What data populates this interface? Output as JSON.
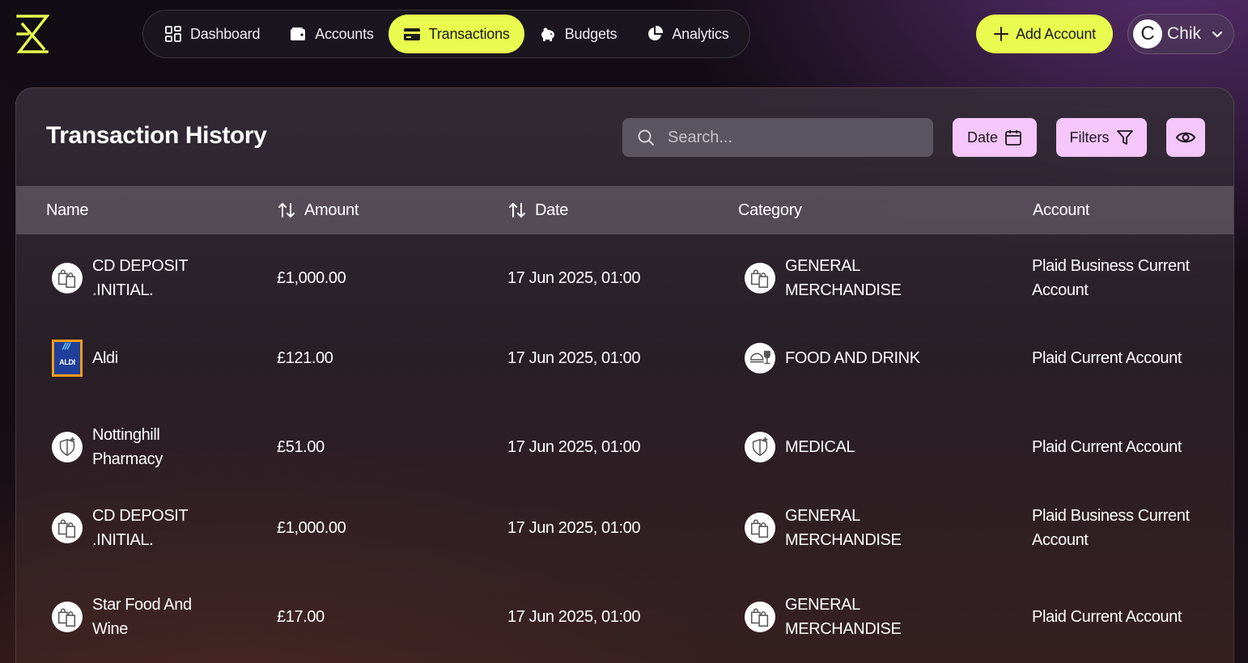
{
  "nav": {
    "items": [
      {
        "label": "Dashboard",
        "icon": "dashboard-icon"
      },
      {
        "label": "Accounts",
        "icon": "wallet-icon"
      },
      {
        "label": "Transactions",
        "icon": "credit-card-icon",
        "active": true
      },
      {
        "label": "Budgets",
        "icon": "piggy-bank-icon"
      },
      {
        "label": "Analytics",
        "icon": "pie-chart-icon"
      }
    ]
  },
  "header": {
    "add_account_label": "Add Account",
    "user_initial": "C",
    "user_name": "Chik"
  },
  "card": {
    "title": "Transaction History",
    "search_placeholder": "Search...",
    "date_button": "Date",
    "filters_button": "Filters"
  },
  "table": {
    "headers": {
      "name": "Name",
      "amount": "Amount",
      "date": "Date",
      "category": "Category",
      "account": "Account"
    },
    "rows": [
      {
        "name_l1": "CD DEPOSIT",
        "name_l2": ".INITIAL.",
        "icon": "shopping-bags-icon",
        "amount": "£1,000.00",
        "date": "17 Jun 2025, 01:00",
        "cat_l1": "GENERAL",
        "cat_l2": "MERCHANDISE",
        "cat_icon": "shopping-bags-icon",
        "acc_l1": "Plaid Business Current",
        "acc_l2": "Account"
      },
      {
        "name_l1": "Aldi",
        "name_l2": "",
        "icon": "aldi-logo",
        "logo_text": "ALDI",
        "amount": "£121.00",
        "date": "17 Jun 2025, 01:00",
        "cat_l1": "FOOD AND DRINK",
        "cat_l2": "",
        "cat_icon": "food-drink-icon",
        "acc_l1": "Plaid Current Account",
        "acc_l2": ""
      },
      {
        "name_l1": "Nottinghill",
        "name_l2": "Pharmacy",
        "icon": "medical-icon",
        "amount": "£51.00",
        "date": "17 Jun 2025, 01:00",
        "cat_l1": "MEDICAL",
        "cat_l2": "",
        "cat_icon": "medical-icon",
        "acc_l1": "Plaid Current Account",
        "acc_l2": ""
      },
      {
        "name_l1": "CD DEPOSIT",
        "name_l2": ".INITIAL.",
        "icon": "shopping-bags-icon",
        "amount": "£1,000.00",
        "date": "17 Jun 2025, 01:00",
        "cat_l1": "GENERAL",
        "cat_l2": "MERCHANDISE",
        "cat_icon": "shopping-bags-icon",
        "acc_l1": "Plaid Business Current",
        "acc_l2": "Account"
      },
      {
        "name_l1": "Star Food And",
        "name_l2": "Wine",
        "icon": "shopping-bags-icon",
        "amount": "£17.00",
        "date": "17 Jun 2025, 01:00",
        "cat_l1": "GENERAL",
        "cat_l2": "MERCHANDISE",
        "cat_icon": "shopping-bags-icon",
        "acc_l1": "Plaid Current Account",
        "acc_l2": ""
      }
    ]
  },
  "colors": {
    "accent": "#e8fb4e",
    "action_pill": "#f4c6f9"
  }
}
